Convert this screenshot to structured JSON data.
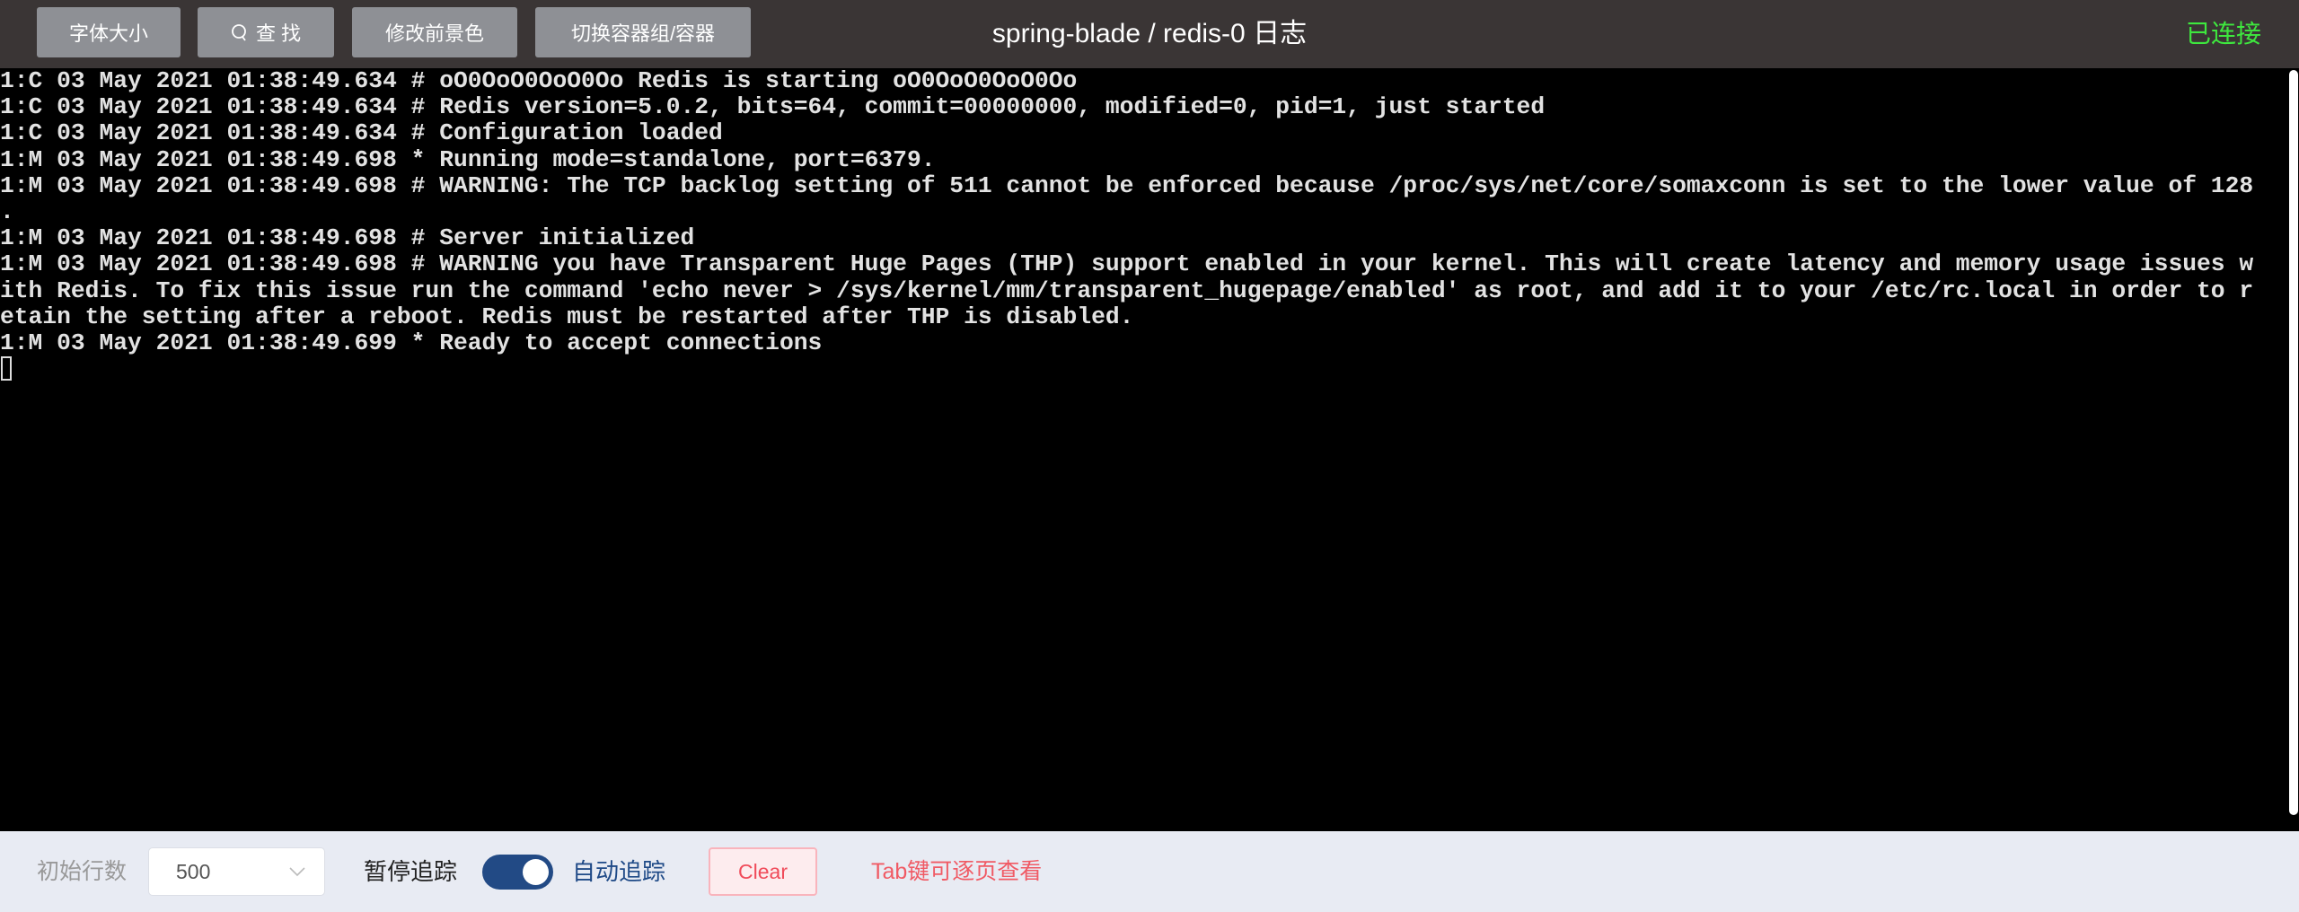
{
  "toolbar": {
    "font_size_label": "字体大小",
    "search_label": "查 找",
    "fg_color_label": "修改前景色",
    "switch_container_label": "切换容器组/容器"
  },
  "header": {
    "title": "spring-blade / redis-0 日志",
    "status": "已连接",
    "status_color": "#3ee83e"
  },
  "log": {
    "rows": [
      "1:C 03 May 2021 01:38:49.634 # oO0OoO0OoO0Oo Redis is starting oO0OoO0OoO0Oo",
      "1:C 03 May 2021 01:38:49.634 # Redis version=5.0.2, bits=64, commit=00000000, modified=0, pid=1, just started",
      "1:C 03 May 2021 01:38:49.634 # Configuration loaded",
      "1:M 03 May 2021 01:38:49.698 * Running mode=standalone, port=6379.",
      "1:M 03 May 2021 01:38:49.698 # WARNING: The TCP backlog setting of 511 cannot be enforced because /proc/sys/net/core/somaxconn is set to the lower value of 128",
      ".",
      "1:M 03 May 2021 01:38:49.698 # Server initialized",
      "1:M 03 May 2021 01:38:49.698 # WARNING you have Transparent Huge Pages (THP) support enabled in your kernel. This will create latency and memory usage issues w",
      "ith Redis. To fix this issue run the command 'echo never > /sys/kernel/mm/transparent_hugepage/enabled' as root, and add it to your /etc/rc.local in order to r",
      "etain the setting after a reboot. Redis must be restarted after THP is disabled.",
      "1:M 03 May 2021 01:38:49.699 * Ready to accept connections"
    ]
  },
  "footer": {
    "initial_lines_label": "初始行数",
    "initial_lines_value": "500",
    "pause_label": "暂停追踪",
    "auto_follow_label": "自动追踪",
    "auto_follow_on": true,
    "clear_label": "Clear",
    "tab_hint": "Tab键可逐页查看"
  }
}
